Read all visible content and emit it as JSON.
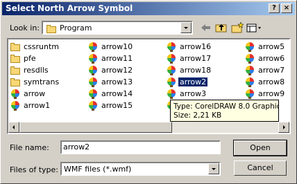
{
  "window": {
    "title": "Select North Arrow Symbol",
    "help_label": "?",
    "close_label": "×"
  },
  "lookin": {
    "label": "Look in:",
    "value": "Program"
  },
  "toolbar": {
    "icons": [
      "back-icon",
      "up-folder-icon",
      "new-folder-icon",
      "view-menu-icon"
    ]
  },
  "files": {
    "col1": [
      {
        "name": "cssruntm",
        "type": "folder"
      },
      {
        "name": "pfe",
        "type": "folder"
      },
      {
        "name": "resdlls",
        "type": "folder"
      },
      {
        "name": "symtrans",
        "type": "folder"
      },
      {
        "name": "arrow",
        "type": "wmf"
      },
      {
        "name": "arrow1",
        "type": "wmf"
      }
    ],
    "col2": [
      {
        "name": "arrow10",
        "type": "wmf"
      },
      {
        "name": "arrow11",
        "type": "wmf"
      },
      {
        "name": "arrow12",
        "type": "wmf"
      },
      {
        "name": "arrow13",
        "type": "wmf"
      },
      {
        "name": "arrow14",
        "type": "wmf"
      },
      {
        "name": "arrow15",
        "type": "wmf"
      }
    ],
    "col3": [
      {
        "name": "arrow16",
        "type": "wmf"
      },
      {
        "name": "arrow17",
        "type": "wmf"
      },
      {
        "name": "arrow18",
        "type": "wmf"
      },
      {
        "name": "arrow2",
        "type": "wmf",
        "selected": true
      },
      {
        "name": "arrow3",
        "type": "wmf"
      },
      {
        "name": "",
        "type": "wmf"
      }
    ],
    "col4": [
      {
        "name": "arrow5",
        "type": "wmf"
      },
      {
        "name": "arrow6",
        "type": "wmf"
      },
      {
        "name": "arrow7",
        "type": "wmf"
      },
      {
        "name": "arrow8",
        "type": "wmf"
      },
      {
        "name": "arrow9",
        "type": "wmf"
      },
      {
        "name": "",
        "type": "wmf"
      }
    ]
  },
  "tooltip": {
    "line1": "Type: CorelDRAW 8.0 Graphic",
    "line2": "Size: 2,21 KB"
  },
  "filename": {
    "label": "File name:",
    "value": "arrow2"
  },
  "filetype": {
    "label": "Files of type:",
    "value": "WMF files (*.wmf)"
  },
  "buttons": {
    "open": "Open",
    "cancel": "Cancel"
  },
  "colors": {
    "title_start": "#0a246a",
    "title_end": "#a6caf0",
    "selection": "#0a246a",
    "tooltip_bg": "#ffffe1",
    "face": "#d4d0c8"
  }
}
